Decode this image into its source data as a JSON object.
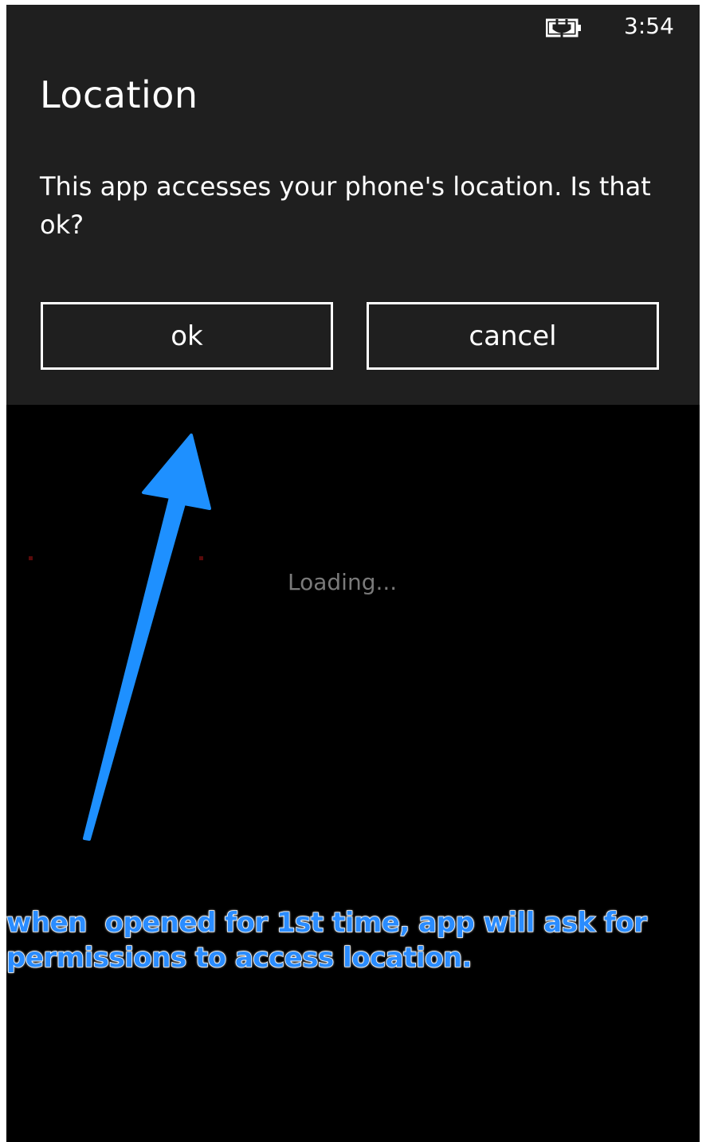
{
  "status_bar": {
    "battery_icon": "battery-charging-icon",
    "time": "3:54"
  },
  "dialog": {
    "title": "Location",
    "message": "This app accesses your phone's location. Is that ok?",
    "ok_label": "ok",
    "cancel_label": "cancel"
  },
  "main": {
    "loading_text": "Loading..."
  },
  "annotation": {
    "line1": "when  opened for 1st time, app will ask for",
    "line2": "permissions to access location.",
    "color": "#2a8cff",
    "arrow_icon": "annotation-arrow-icon"
  },
  "colors": {
    "dialog_bg": "#1f1f1f",
    "screen_bg": "#000000",
    "text": "#ffffff",
    "loading_text": "#7a7a7a",
    "accent_arrow": "#1e90ff"
  }
}
